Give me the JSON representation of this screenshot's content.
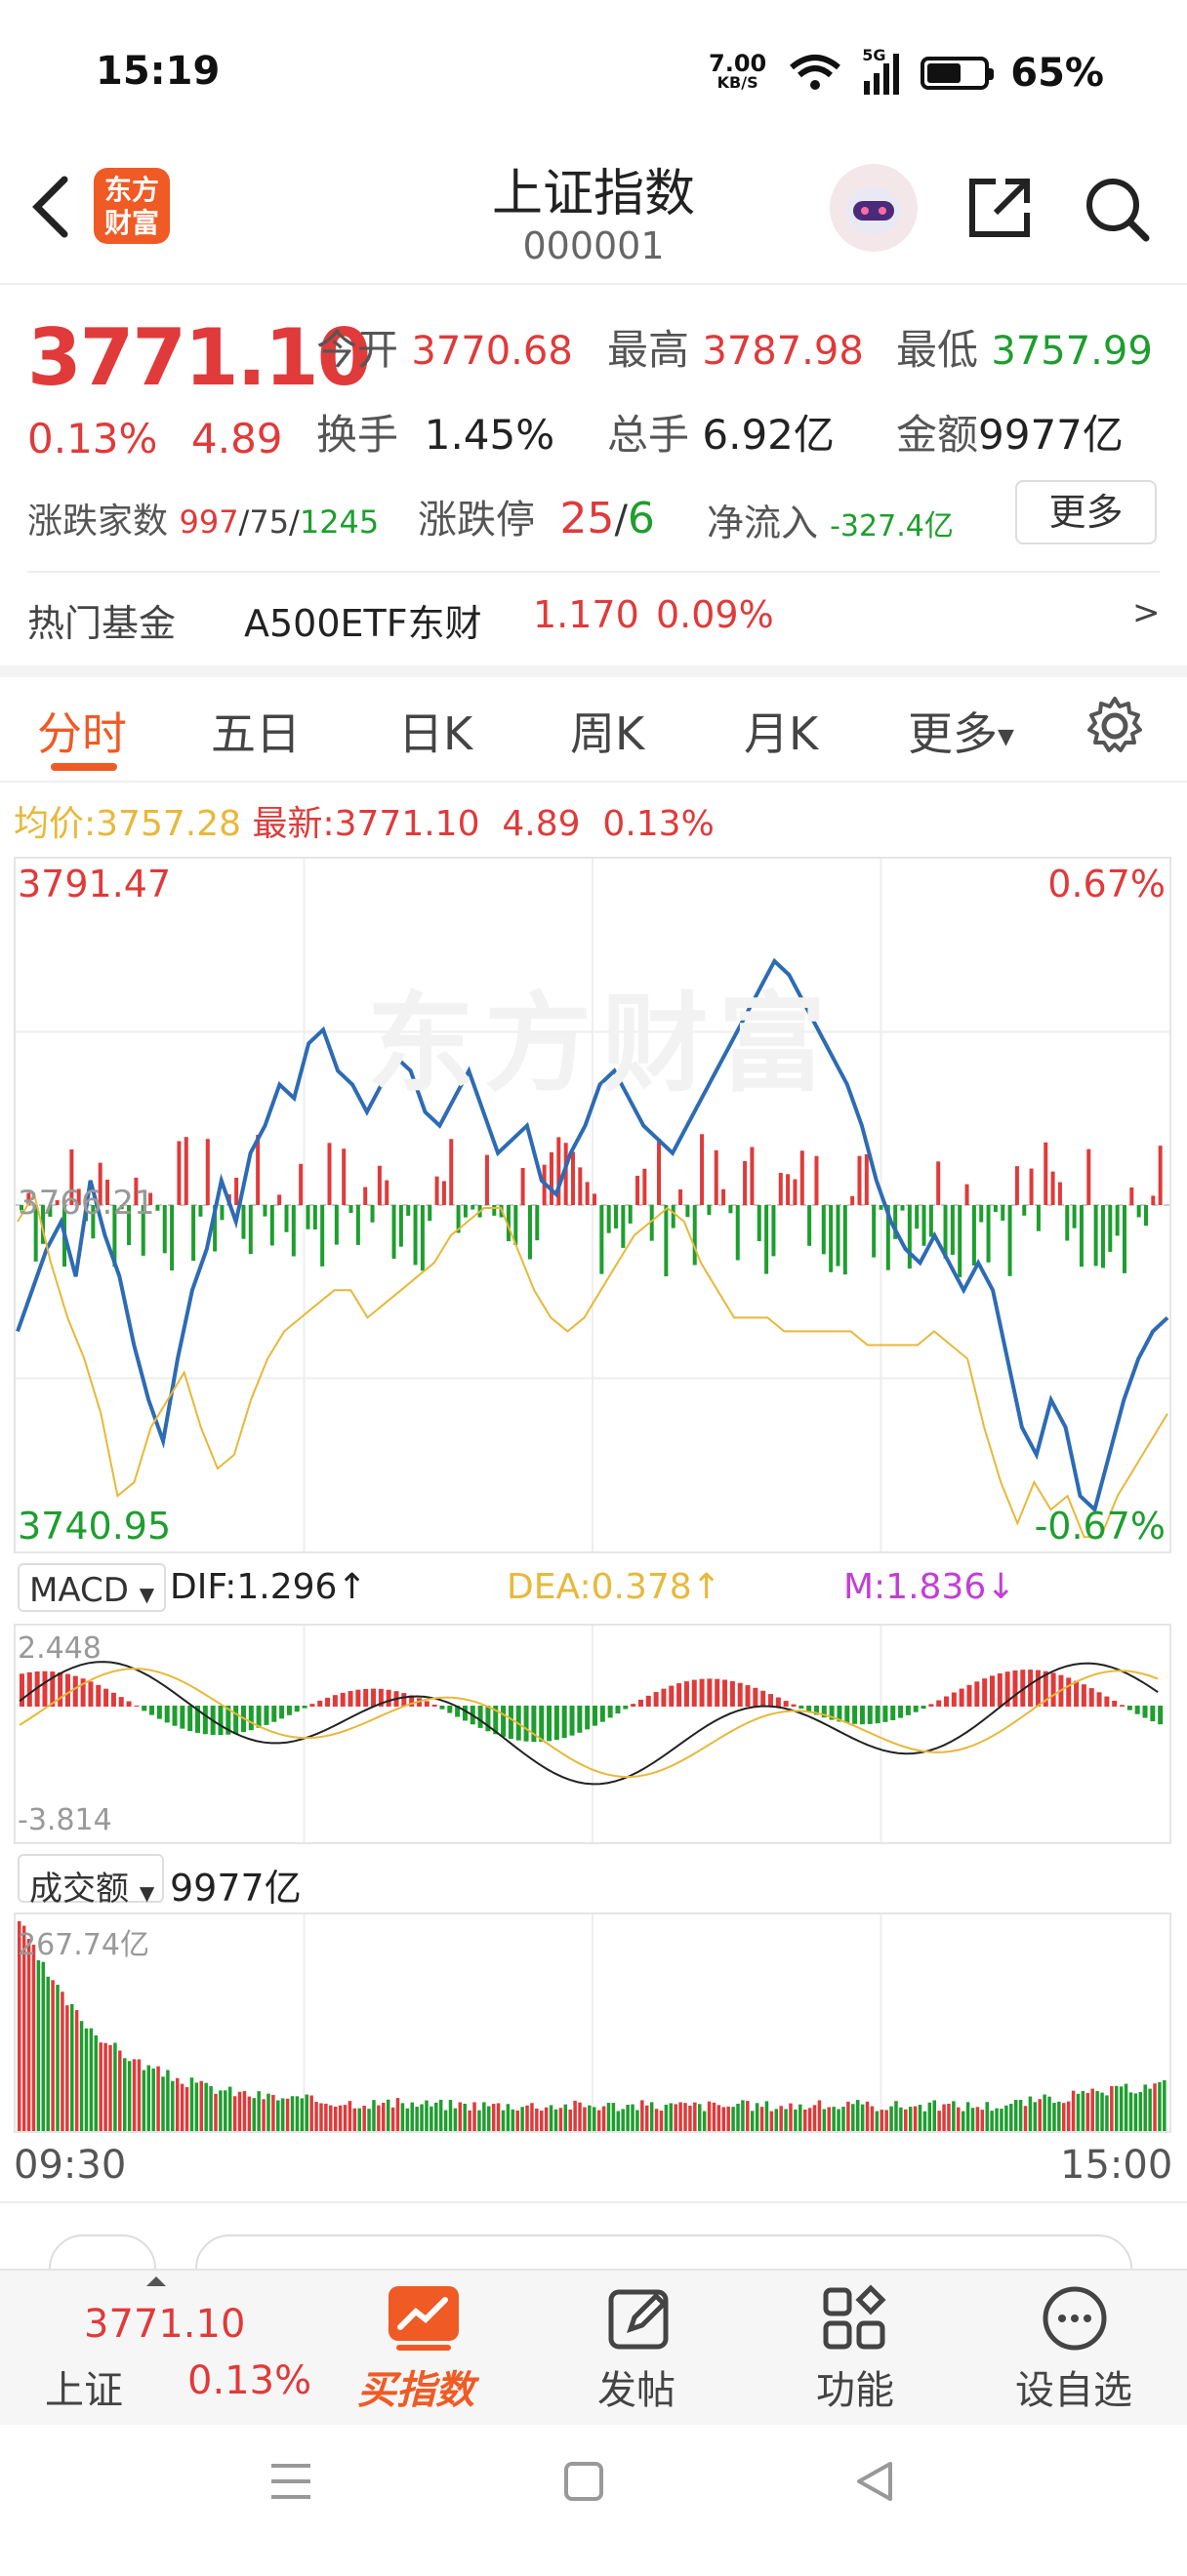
{
  "status": {
    "time": "15:19",
    "net_speed_value": "7.00",
    "net_speed_unit": "KB/S",
    "network": "5G",
    "battery": "65%"
  },
  "header": {
    "title": "上证指数",
    "code": "000001",
    "logo_line1": "东方",
    "logo_line2": "财富"
  },
  "quote": {
    "price": "3771.10",
    "change_pct": "0.13%",
    "change": "4.89",
    "open_label": "今开",
    "open": "3770.68",
    "high_label": "最高",
    "high": "3787.98",
    "low_label": "最低",
    "low": "3757.99",
    "turnover_label": "换手",
    "turnover": "1.45%",
    "volume_label": "总手",
    "volume": "6.92亿",
    "amount_label": "金额",
    "amount": "9977亿",
    "breadth_label": "涨跌家数",
    "up_count": "997",
    "flat_count": "75",
    "down_count": "1245",
    "limit_label": "涨跌停",
    "limit_up": "25",
    "limit_down": "6",
    "inflow_label": "净流入",
    "inflow": "-327.4亿",
    "more_label": "更多"
  },
  "hot_fund": {
    "label": "热门基金",
    "name": "A500ETF东财",
    "price": "1.170",
    "pct": "0.09%",
    "arrow": ">"
  },
  "tabs": [
    "分时",
    "五日",
    "日K",
    "周K",
    "月K",
    "更多"
  ],
  "chart_info": {
    "avg_label": "均价:",
    "avg": "3757.28",
    "latest_label": "最新:",
    "latest": "3771.10",
    "chg": "4.89",
    "pct": "0.13%"
  },
  "chart_data": [
    {
      "type": "line",
      "ylim": [
        3740.95,
        3791.47
      ],
      "y_labels": {
        "top": "3791.47",
        "mid": "3766.21",
        "bottom": "3740.95",
        "top_pct": "0.67%",
        "bottom_pct": "-0.67%"
      },
      "x_labels": [
        "09:30",
        "15:00"
      ],
      "grid": true,
      "watermark": "东方财富",
      "series": [
        {
          "name": "最新",
          "color": "#2d6bb4",
          "values": [
            3757,
            3760,
            3763,
            3765,
            3761,
            3768,
            3764,
            3761,
            3756,
            3752,
            3749,
            3755,
            3760,
            3763,
            3768,
            3765,
            3770,
            3772,
            3775,
            3774,
            3778,
            3779,
            3776,
            3775,
            3773,
            3775,
            3777,
            3776,
            3773,
            3772,
            3774,
            3776,
            3773,
            3770,
            3771,
            3772,
            3768,
            3767,
            3770,
            3772,
            3775,
            3776,
            3774,
            3772,
            3771,
            3770,
            3772,
            3774,
            3776,
            3778,
            3780,
            3782,
            3784,
            3783,
            3781,
            3779,
            3777,
            3775,
            3772,
            3768,
            3765,
            3763,
            3762,
            3764,
            3762,
            3760,
            3762,
            3760,
            3755,
            3750,
            3748,
            3752,
            3750,
            3745,
            3744,
            3748,
            3752,
            3755,
            3757,
            3758
          ]
        },
        {
          "name": "均价",
          "color": "#e8b83a",
          "values": [
            3765,
            3767,
            3762,
            3758,
            3755,
            3751,
            3745,
            3746,
            3750,
            3752,
            3754,
            3750,
            3747,
            3748,
            3752,
            3755,
            3757,
            3758,
            3759,
            3760,
            3760,
            3758,
            3759,
            3760,
            3761,
            3762,
            3764,
            3765,
            3766,
            3766,
            3763,
            3760,
            3758,
            3757,
            3758,
            3760,
            3762,
            3764,
            3765,
            3766,
            3765,
            3762,
            3760,
            3758,
            3758,
            3758,
            3757,
            3757,
            3757,
            3757,
            3757,
            3756,
            3756,
            3756,
            3756,
            3757,
            3756,
            3755,
            3750,
            3746,
            3743,
            3746,
            3744,
            3745,
            3742,
            3742,
            3745,
            3747,
            3749,
            3751
          ]
        }
      ]
    },
    {
      "type": "bar",
      "name": "MACD",
      "indicators": {
        "dif": "DIF:1.296↑",
        "dea": "DEA:0.378↑",
        "m": "M:1.836↓"
      },
      "ylim": [
        -3.814,
        2.448
      ],
      "y_labels": {
        "top": "2.448",
        "bottom": "-3.814"
      }
    },
    {
      "type": "bar",
      "name": "成交额",
      "total": "9977亿",
      "y_labels": {
        "top": "267.74亿"
      },
      "x_labels": [
        "09:30",
        "15:00"
      ]
    }
  ],
  "colors": {
    "up": "#e03a3a",
    "down": "#1e9e2e",
    "brand": "#f05a24",
    "line": "#2d6bb4",
    "avg": "#e8b83a"
  },
  "bottom_nav": {
    "index_price": "3771.10",
    "index_name": "上证",
    "index_pct": "0.13%",
    "buy_label": "买指数",
    "post_label": "发帖",
    "func_label": "功能",
    "watch_label": "设自选"
  }
}
